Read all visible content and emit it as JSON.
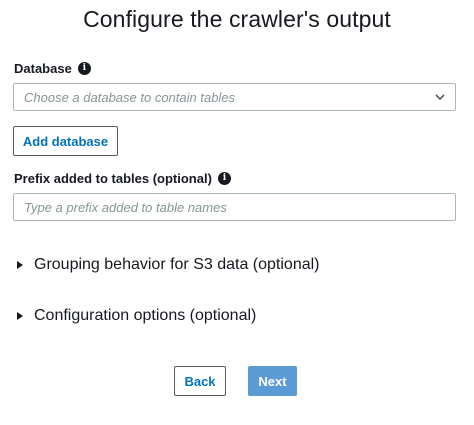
{
  "page": {
    "title": "Configure the crawler's output"
  },
  "database": {
    "label": "Database",
    "info_icon": "info-icon",
    "placeholder": "Choose a database to contain tables",
    "dropdown_icon": "chevron-down-icon",
    "add_button": "Add database"
  },
  "prefix": {
    "label": "Prefix added to tables (optional)",
    "info_icon": "info-icon",
    "placeholder": "Type a prefix added to table names"
  },
  "sections": [
    {
      "label": "Grouping behavior for S3 data (optional)",
      "icon": "caret-right-icon"
    },
    {
      "label": "Configuration options (optional)",
      "icon": "caret-right-icon"
    }
  ],
  "footer": {
    "back_label": "Back",
    "next_label": "Next"
  },
  "colors": {
    "link_blue": "#0073bb",
    "primary_button": "#5a9bd5",
    "border": "#aab7b8",
    "placeholder": "#879596"
  }
}
